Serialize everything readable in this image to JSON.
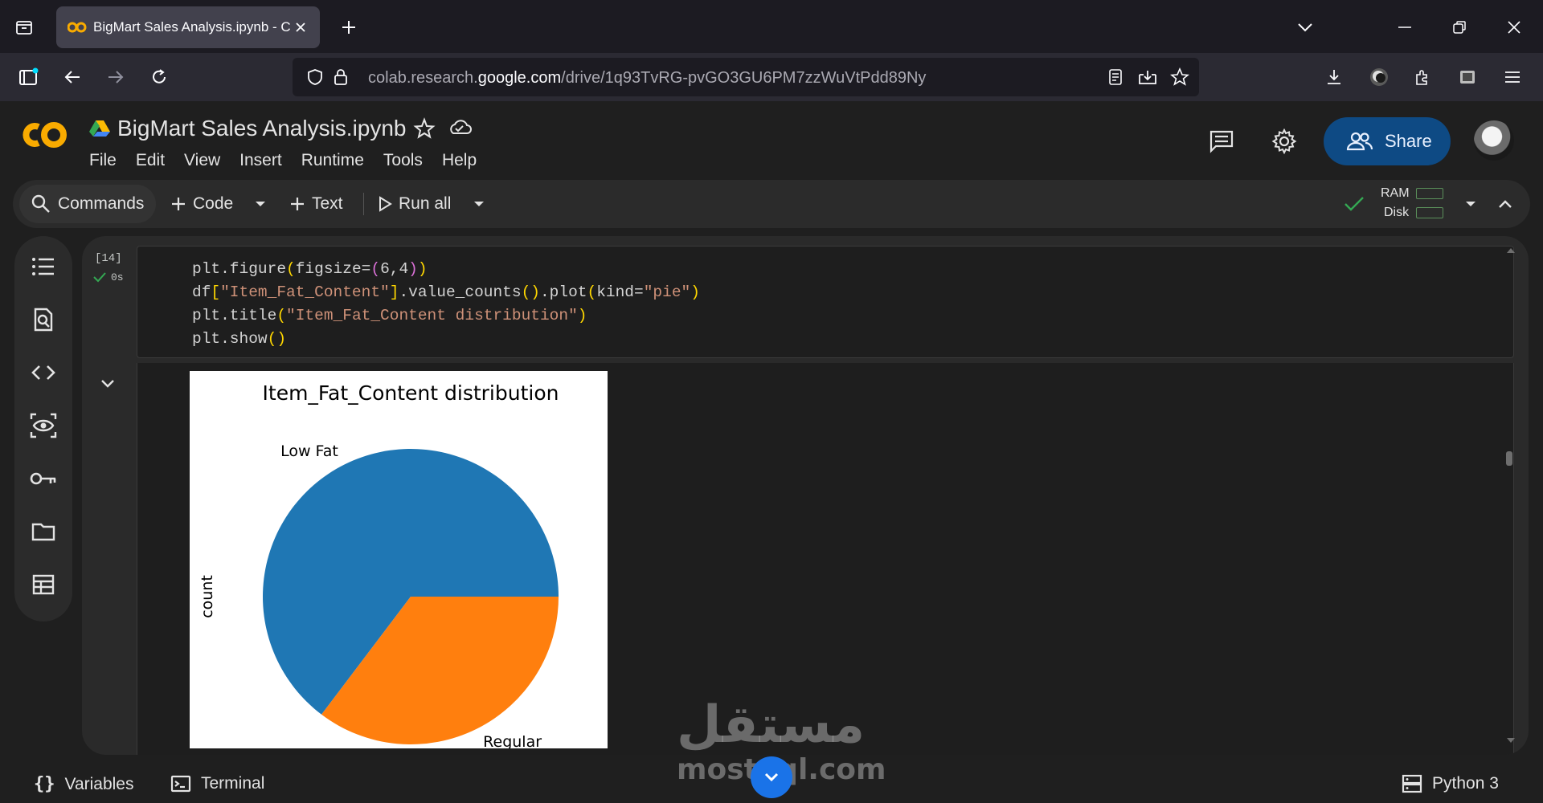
{
  "browser": {
    "tab_title": "BigMart Sales Analysis.ipynb - C",
    "url_prefix": "colab.research.",
    "url_domain": "google.com",
    "url_path": "/drive/1q93TvRG-pvGO3GU6PM7zzWuVtPdd89Ny"
  },
  "colab": {
    "notebook_title": "BigMart Sales Analysis.ipynb",
    "menu": [
      "File",
      "Edit",
      "View",
      "Insert",
      "Runtime",
      "Tools",
      "Help"
    ],
    "share_label": "Share"
  },
  "toolbar": {
    "commands_label": "Commands",
    "code_label": "Code",
    "text_label": "Text",
    "run_all_label": "Run all",
    "ram_label": "RAM",
    "disk_label": "Disk"
  },
  "cell": {
    "exec_count": "[14]",
    "exec_time": "0s",
    "code_lines": [
      "plt.figure(figsize=(6,4))",
      "df[\"Item_Fat_Content\"].value_counts().plot(kind=\"pie\")",
      "plt.title(\"Item_Fat_Content distribution\")",
      "plt.show()"
    ]
  },
  "chart_data": {
    "type": "pie",
    "title": "Item_Fat_Content distribution",
    "ylabel": "count",
    "categories": [
      "Low Fat",
      "Regular"
    ],
    "values": [
      64.7,
      35.3
    ],
    "colors": [
      "#1f77b4",
      "#ff7f0e"
    ]
  },
  "statusbar": {
    "variables_label": "Variables",
    "terminal_label": "Terminal",
    "runtime_label": "Python 3"
  },
  "watermark": {
    "arabic": "مستقل",
    "latin": "mostaql.com"
  },
  "colors": {
    "accent": "#0e4a84",
    "colab_orange": "#f9ab00",
    "check_green": "#34a853"
  }
}
